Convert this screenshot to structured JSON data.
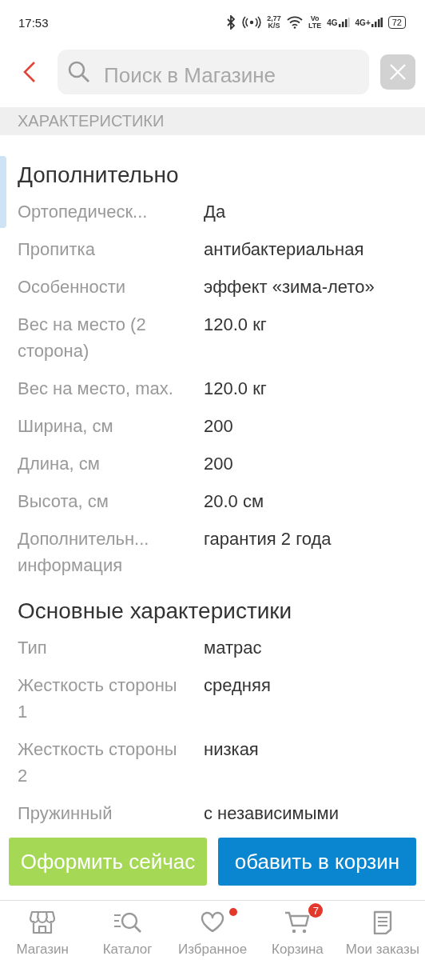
{
  "status_bar": {
    "time": "17:53",
    "speed": [
      "2,77",
      "K/S"
    ],
    "volte": [
      "Vo",
      "LTE"
    ],
    "sim1": "4G",
    "sim2": "4G+",
    "battery": "72"
  },
  "search": {
    "placeholder": "Поиск в Магазине"
  },
  "section_title": "ХАРАКТЕРИСТИКИ",
  "groups": [
    {
      "title": "Дополнительно",
      "rows": [
        {
          "label": "Ортопедическ...",
          "value": "Да"
        },
        {
          "label": "Пропитка",
          "value": "антибактериальная"
        },
        {
          "label": "Особенности",
          "value": "эффект «зима-лето»"
        },
        {
          "label": "Вес на место (2 сторона)",
          "value": "120.0 кг"
        },
        {
          "label": "Вес на место, max.",
          "value": "120.0 кг"
        },
        {
          "label": "Ширина, см",
          "value": "200"
        },
        {
          "label": "Длина, см",
          "value": "200"
        },
        {
          "label": "Высота, см",
          "value": "20.0 см"
        },
        {
          "label": "Дополнительн... информация",
          "value": "гарантия 2 года"
        }
      ]
    },
    {
      "title": "Основные характеристики",
      "rows": [
        {
          "label": "Тип",
          "value": "матрас"
        },
        {
          "label": "Жесткость стороны 1",
          "value": "средняя"
        },
        {
          "label": "Жесткость стороны 2",
          "value": "низкая"
        },
        {
          "label": "Пружинный",
          "value": "с независимыми"
        }
      ]
    }
  ],
  "actions": [
    {
      "label": "Оформить сейчас",
      "kind": "primary"
    },
    {
      "label": "обавить в корзин",
      "kind": "secondary"
    }
  ],
  "nav": [
    {
      "label": "Магазин",
      "kind": "store"
    },
    {
      "label": "Каталог",
      "kind": "catalog"
    },
    {
      "label": "Избранное",
      "kind": "favorites",
      "dot": true
    },
    {
      "label": "Корзина",
      "kind": "cart",
      "badge": "7"
    },
    {
      "label": "Мои заказы",
      "kind": "orders"
    }
  ]
}
